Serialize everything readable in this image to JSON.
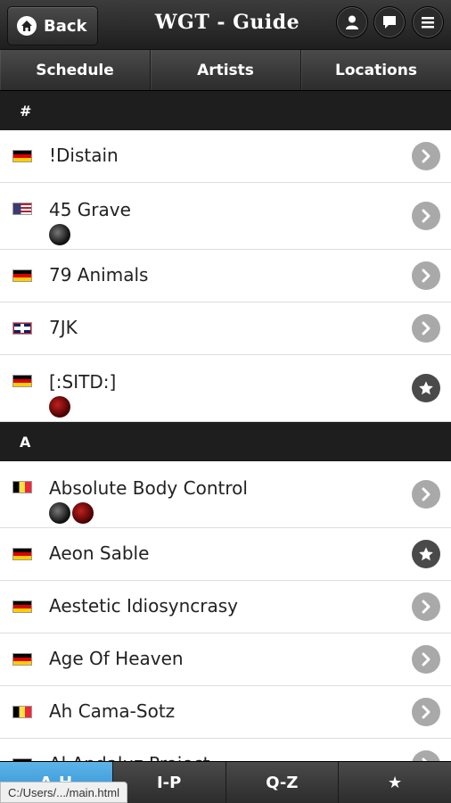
{
  "header": {
    "back_label": "Back",
    "title": "WGT - Guide",
    "icons": [
      "home-icon",
      "user-icon",
      "chat-icon",
      "menu-icon"
    ]
  },
  "nav_tabs": [
    "Schedule",
    "Artists",
    "Locations"
  ],
  "sections": [
    {
      "letter": "#",
      "items": [
        {
          "name": "!Distain",
          "flag": "de",
          "badges": [],
          "action": "chevron"
        },
        {
          "name": "45 Grave",
          "flag": "us",
          "badges": [
            "dark"
          ],
          "action": "chevron"
        },
        {
          "name": "79 Animals",
          "flag": "de",
          "badges": [],
          "action": "chevron"
        },
        {
          "name": "7JK",
          "flag": "uk",
          "badges": [],
          "action": "chevron"
        },
        {
          "name": "[:SITD:]",
          "flag": "de",
          "badges": [
            "red"
          ],
          "action": "star"
        }
      ]
    },
    {
      "letter": "A",
      "items": [
        {
          "name": "Absolute Body Control",
          "flag": "be",
          "badges": [
            "dark",
            "red"
          ],
          "action": "chevron"
        },
        {
          "name": "Aeon Sable",
          "flag": "de",
          "badges": [],
          "action": "star"
        },
        {
          "name": "Aestetic Idiosyncrasy",
          "flag": "de",
          "badges": [],
          "action": "chevron"
        },
        {
          "name": "Age Of Heaven",
          "flag": "de",
          "badges": [],
          "action": "chevron"
        },
        {
          "name": "Ah Cama-Sotz",
          "flag": "be",
          "badges": [],
          "action": "chevron"
        },
        {
          "name": "Al Andaluz Project",
          "flag": "de",
          "badges": [],
          "action": "chevron"
        }
      ]
    }
  ],
  "bottom_tabs": [
    "A-H",
    "I-P",
    "Q-Z",
    "★"
  ],
  "active_bottom_tab": 0,
  "status_bar": "C:/Users/.../main.html",
  "colors": {
    "active_tab": "#3a9ad9",
    "divider": "#1e1e1e",
    "chevron": "#a9a9a9",
    "star": "#4a4a4a"
  }
}
